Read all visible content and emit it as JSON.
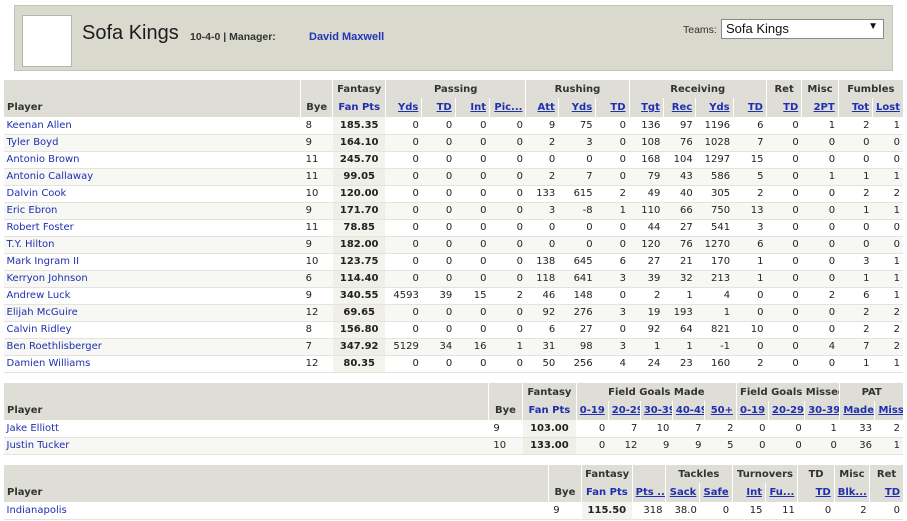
{
  "header": {
    "team_name": "Sofa Kings",
    "record": "10-4-0 | Manager:",
    "manager": "David Maxwell",
    "teams_label": "Teams:",
    "selected_team": "Sofa Kings"
  },
  "players": {
    "groups": [
      "",
      "",
      "Fantasy",
      "Passing",
      "Rushing",
      "Receiving",
      "Ret",
      "Misc",
      "Fumbles"
    ],
    "columns": [
      "Player",
      "Bye",
      "Fan Pts",
      "Yds",
      "TD",
      "Int",
      "Pic...",
      "Att",
      "Yds",
      "TD",
      "Tgt",
      "Rec",
      "Yds",
      "TD",
      "TD",
      "2PT",
      "Tot",
      "Lost"
    ],
    "rows": [
      [
        "Keenan Allen",
        "8",
        "185.35",
        "0",
        "0",
        "0",
        "0",
        "9",
        "75",
        "0",
        "136",
        "97",
        "1196",
        "6",
        "0",
        "1",
        "2",
        "1"
      ],
      [
        "Tyler Boyd",
        "9",
        "164.10",
        "0",
        "0",
        "0",
        "0",
        "2",
        "3",
        "0",
        "108",
        "76",
        "1028",
        "7",
        "0",
        "0",
        "0",
        "0"
      ],
      [
        "Antonio Brown",
        "11",
        "245.70",
        "0",
        "0",
        "0",
        "0",
        "0",
        "0",
        "0",
        "168",
        "104",
        "1297",
        "15",
        "0",
        "0",
        "0",
        "0"
      ],
      [
        "Antonio Callaway",
        "11",
        "99.05",
        "0",
        "0",
        "0",
        "0",
        "2",
        "7",
        "0",
        "79",
        "43",
        "586",
        "5",
        "0",
        "1",
        "1",
        "1"
      ],
      [
        "Dalvin Cook",
        "10",
        "120.00",
        "0",
        "0",
        "0",
        "0",
        "133",
        "615",
        "2",
        "49",
        "40",
        "305",
        "2",
        "0",
        "0",
        "2",
        "2"
      ],
      [
        "Eric Ebron",
        "9",
        "171.70",
        "0",
        "0",
        "0",
        "0",
        "3",
        "-8",
        "1",
        "110",
        "66",
        "750",
        "13",
        "0",
        "0",
        "1",
        "1"
      ],
      [
        "Robert Foster",
        "11",
        "78.85",
        "0",
        "0",
        "0",
        "0",
        "0",
        "0",
        "0",
        "44",
        "27",
        "541",
        "3",
        "0",
        "0",
        "0",
        "0"
      ],
      [
        "T.Y. Hilton",
        "9",
        "182.00",
        "0",
        "0",
        "0",
        "0",
        "0",
        "0",
        "0",
        "120",
        "76",
        "1270",
        "6",
        "0",
        "0",
        "0",
        "0"
      ],
      [
        "Mark Ingram II",
        "10",
        "123.75",
        "0",
        "0",
        "0",
        "0",
        "138",
        "645",
        "6",
        "27",
        "21",
        "170",
        "1",
        "0",
        "0",
        "3",
        "1"
      ],
      [
        "Kerryon Johnson",
        "6",
        "114.40",
        "0",
        "0",
        "0",
        "0",
        "118",
        "641",
        "3",
        "39",
        "32",
        "213",
        "1",
        "0",
        "0",
        "1",
        "1"
      ],
      [
        "Andrew Luck",
        "9",
        "340.55",
        "4593",
        "39",
        "15",
        "2",
        "46",
        "148",
        "0",
        "2",
        "1",
        "4",
        "0",
        "0",
        "2",
        "6",
        "1"
      ],
      [
        "Elijah McGuire",
        "12",
        "69.65",
        "0",
        "0",
        "0",
        "0",
        "92",
        "276",
        "3",
        "19",
        "193",
        "1",
        "0",
        "0",
        "0",
        "2",
        "2"
      ],
      [
        "Calvin Ridley",
        "8",
        "156.80",
        "0",
        "0",
        "0",
        "0",
        "6",
        "27",
        "0",
        "92",
        "64",
        "821",
        "10",
        "0",
        "0",
        "2",
        "2"
      ],
      [
        "Ben Roethlisberger",
        "7",
        "347.92",
        "5129",
        "34",
        "16",
        "1",
        "31",
        "98",
        "3",
        "1",
        "1",
        "-1",
        "0",
        "0",
        "4",
        "7",
        "2"
      ],
      [
        "Damien Williams",
        "12",
        "80.35",
        "0",
        "0",
        "0",
        "0",
        "50",
        "256",
        "4",
        "24",
        "23",
        "160",
        "2",
        "0",
        "0",
        "1",
        "1"
      ]
    ]
  },
  "kickers": {
    "groups": [
      "",
      "",
      "Fantasy",
      "Field Goals Made",
      "Field Goals Missed",
      "PAT"
    ],
    "columns": [
      "Player",
      "Bye",
      "Fan Pts",
      "0-19",
      "20-29",
      "30-39",
      "40-49",
      "50+",
      "0-19",
      "20-29",
      "30-39",
      "Made",
      "Miss"
    ],
    "rows": [
      [
        "Jake Elliott",
        "9",
        "103.00",
        "0",
        "7",
        "10",
        "7",
        "2",
        "0",
        "0",
        "1",
        "33",
        "2"
      ],
      [
        "Justin Tucker",
        "10",
        "133.00",
        "0",
        "12",
        "9",
        "9",
        "5",
        "0",
        "0",
        "0",
        "36",
        "1"
      ]
    ]
  },
  "defense": {
    "groups": [
      "",
      "",
      "Fantasy",
      "",
      "Tackles",
      "Turnovers",
      "TD",
      "Misc",
      "Ret"
    ],
    "columns": [
      "Player",
      "Bye",
      "Fan Pts",
      "Pts ...",
      "Sack",
      "Safe",
      "Int",
      "Fu...",
      "TD",
      "Blk...",
      "TD"
    ],
    "rows": [
      [
        "Indianapolis",
        "9",
        "115.50",
        "318",
        "38.0",
        "0",
        "15",
        "11",
        "0",
        "2",
        "0"
      ]
    ]
  }
}
